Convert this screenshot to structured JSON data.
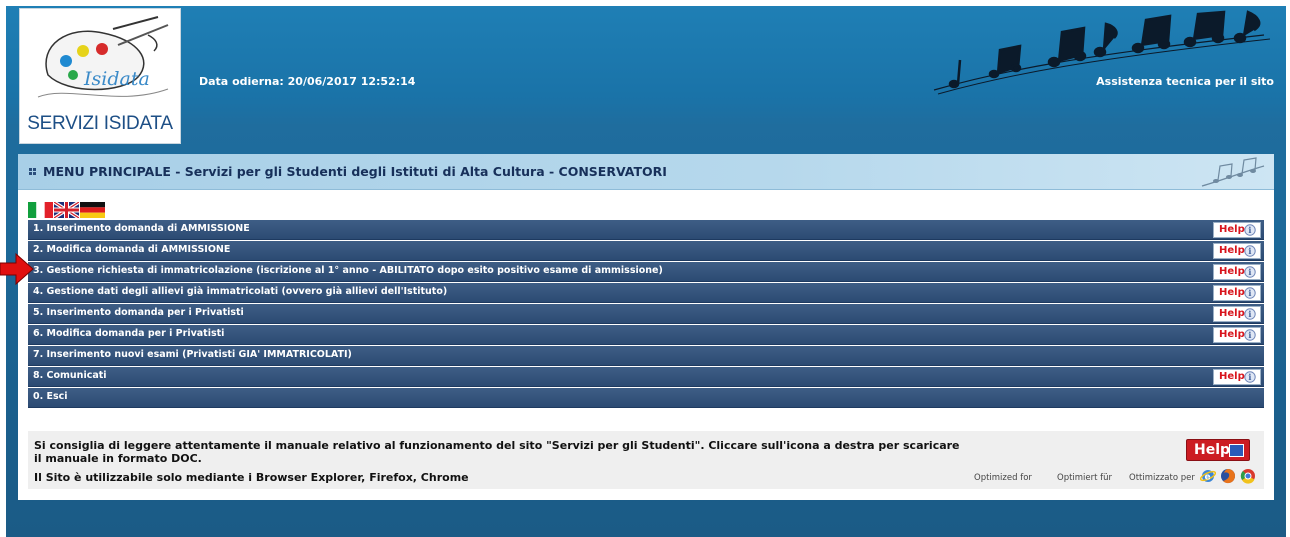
{
  "header": {
    "logo_caption": "SERVIZI ISIDATA",
    "logo_wordmark": "Isidata",
    "date_label": "Data odierna: 20/06/2017 12:52:14",
    "support_link": "Assistenza tecnica per il sito"
  },
  "panel": {
    "title": "MENU PRINCIPALE - Servizi per gli Studenti degli Istituti di Alta Cultura - CONSERVATORI"
  },
  "flags": [
    "flag-italy",
    "flag-uk",
    "flag-germany"
  ],
  "menu": [
    {
      "label": "1. Inserimento domanda di AMMISSIONE",
      "help": "Help"
    },
    {
      "label": "2. Modifica domanda di AMMISSIONE",
      "help": "Help"
    },
    {
      "label": "3. Gestione richiesta di immatricolazione (iscrizione al 1° anno - ABILITATO dopo esito positivo esame di ammissione)",
      "help": "Help"
    },
    {
      "label": "4. Gestione dati degli allievi già immatricolati (ovvero già allievi dell'Istituto)",
      "help": "Help"
    },
    {
      "label": "5. Inserimento domanda per i Privatisti",
      "help": "Help"
    },
    {
      "label": "6. Modifica domanda per i Privatisti",
      "help": "Help"
    },
    {
      "label": "7. Inserimento nuovi esami (Privatisti GIA' IMMATRICOLATI)",
      "help": ""
    },
    {
      "label": "8. Comunicati",
      "help": "Help"
    },
    {
      "label": "0. Esci",
      "help": ""
    }
  ],
  "footer": {
    "manual_note": "Si consiglia di leggere attentamente il manuale relativo al funzionamento del sito \"Servizi per gli Studenti\". Cliccare sull'icona a destra per scaricare il manuale in formato DOC.",
    "browser_note": "Il Sito è utilizzabile solo mediante i Browser Explorer, Firefox, Chrome",
    "help_doc_label": "Help",
    "optimized_en": "Optimized for",
    "optimized_de": "Optimiert für",
    "optimized_it": "Ottimizzato per",
    "browsers": [
      "internet-explorer-icon",
      "firefox-icon",
      "chrome-icon"
    ]
  },
  "colors": {
    "menu_row": "#2c4b73",
    "help_red": "#d8141c",
    "header_blue": "#1f7fb5",
    "arrow_red": "#e01010"
  }
}
